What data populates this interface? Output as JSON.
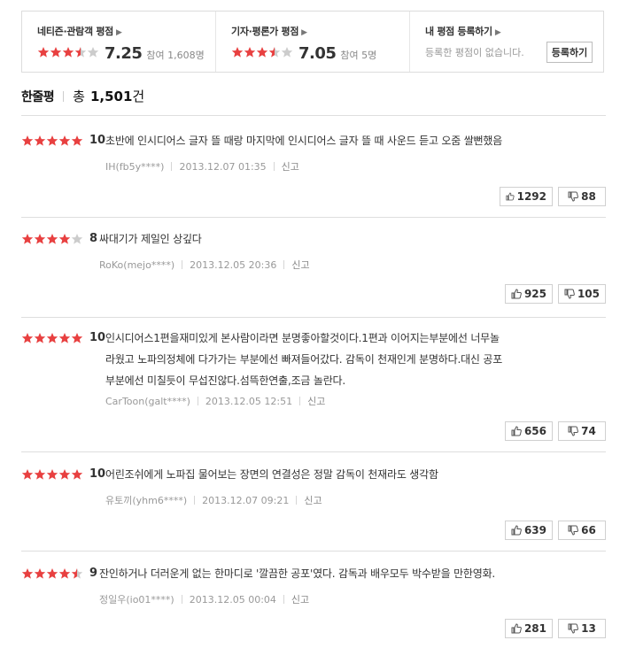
{
  "summary": {
    "netizen": {
      "title": "네티즌·관람객 평점",
      "score": "7.25",
      "count": "참여 1,608명",
      "stars": 3.5
    },
    "critic": {
      "title": "기자·평론가 평점",
      "score": "7.05",
      "count": "참여 5명",
      "stars": 3.5
    },
    "mine": {
      "title": "내 평점 등록하기",
      "none_text": "등록한 평점이 없습니다.",
      "button": "등록하기"
    }
  },
  "header": {
    "title": "한줄평",
    "total_prefix": "총",
    "total": "1,501",
    "unit": "건"
  },
  "colors": {
    "star_on": "#e84040",
    "star_off": "#cccccc"
  },
  "reviews": [
    {
      "stars": 5,
      "score": "10",
      "lines": [
        "초반에 인시디어스 글자 뜰 때랑 마지막에 인시디어스 글자 뜰 때 사운드 듣고 오줌 쌀뻔했음"
      ],
      "user": "IH(fb5y****)",
      "date": "2013.12.07 01:35",
      "report": "신고",
      "likes": "1292",
      "dislikes": "88"
    },
    {
      "stars": 4,
      "score": "8",
      "lines": [
        "싸대기가 제일인 상깊다"
      ],
      "user": "RoKo(mejo****)",
      "date": "2013.12.05 20:36",
      "report": "신고",
      "likes": "925",
      "dislikes": "105"
    },
    {
      "stars": 5,
      "score": "10",
      "lines": [
        "인시디어스1편을재미있게 본사람이라면 분명좋아할것이다.1편과 이어지는부분에선 너무놀",
        "라웠고 노파의정체에 다가가는 부분에선 빠져들어갔다. 감독이 천재인게 분명하다.대신 공포",
        "부분에선 미칠듯이 무섭진않다.섬뜩한연출,조금 놀란다."
      ],
      "user": "CarToon(galt****)",
      "date": "2013.12.05 12:51",
      "report": "신고",
      "likes": "656",
      "dislikes": "74"
    },
    {
      "stars": 5,
      "score": "10",
      "lines": [
        "어린조쉬에게 노파집 물어보는 장면의 연결성은 정말 감독이 천재라도 생각함"
      ],
      "user": "유토끼(yhm6****)",
      "date": "2013.12.07 09:21",
      "report": "신고",
      "likes": "639",
      "dislikes": "66"
    },
    {
      "stars": 4.5,
      "score": "9",
      "lines": [
        "잔인하거나 더러운게 없는 한마디로 '깔끔한 공포'였다. 감독과 배우모두 박수받을 만한영화."
      ],
      "user": "정일우(io01****)",
      "date": "2013.12.05 00:04",
      "report": "신고",
      "likes": "281",
      "dislikes": "13"
    }
  ]
}
